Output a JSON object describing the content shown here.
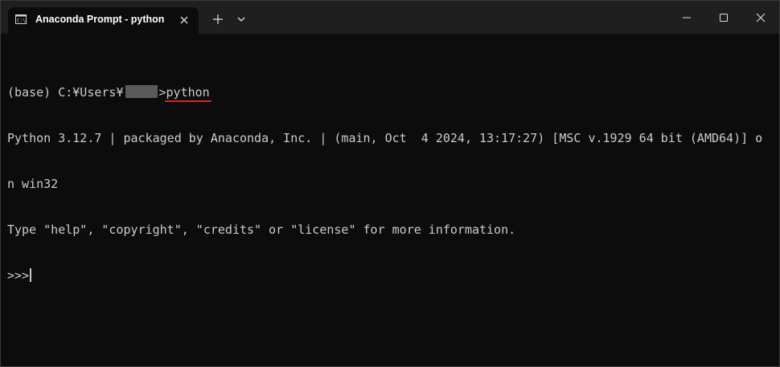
{
  "tab": {
    "title": "Anaconda Prompt - python",
    "icon": "terminal-icon"
  },
  "titlebar": {
    "new_tab_icon": "plus-icon",
    "dropdown_icon": "chevron-down-icon"
  },
  "window_controls": {
    "minimize_icon": "minimize-icon",
    "maximize_icon": "maximize-icon",
    "close_icon": "close-icon"
  },
  "terminal": {
    "prompt_prefix": "(base) C:¥Users¥",
    "prompt_sep": ">",
    "command": "python",
    "line2": "Python 3.12.7 | packaged by Anaconda, Inc. | (main, Oct  4 2024, 13:17:27) [MSC v.1929 64 bit (AMD64)] o",
    "line3": "n win32",
    "line4": "Type \"help\", \"copyright\", \"credits\" or \"license\" for more information.",
    "repl_prompt": ">>> "
  },
  "colors": {
    "background": "#0c0c0c",
    "titlebar": "#1f1f1f",
    "text": "#cccccc",
    "underline_accent": "#d7261e"
  }
}
